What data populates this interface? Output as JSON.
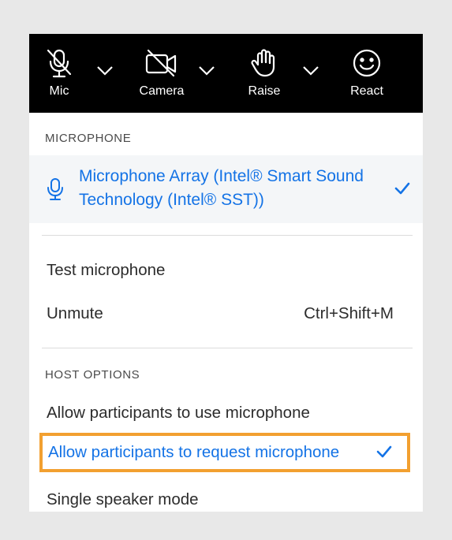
{
  "toolbar": {
    "mic": {
      "label": "Mic",
      "icon": "mic-muted-icon"
    },
    "camera": {
      "label": "Camera",
      "icon": "camera-off-icon"
    },
    "raise": {
      "label": "Raise",
      "icon": "raise-hand-icon"
    },
    "react": {
      "label": "React",
      "icon": "smiley-icon"
    }
  },
  "microphone_section": {
    "header": "MICROPHONE",
    "device_line1": "Microphone Array (Intel® Smart Sound",
    "device_line2": "Technology (Intel® SST))",
    "device_selected": true
  },
  "mic_actions": {
    "test": "Test microphone",
    "unmute": "Unmute",
    "unmute_shortcut": "Ctrl+Shift+M"
  },
  "host_options": {
    "header": "HOST OPTIONS",
    "allow_use": "Allow participants to use microphone",
    "allow_request": "Allow participants to request microphone",
    "allow_request_selected": true,
    "single_speaker": "Single speaker mode"
  },
  "colors": {
    "accent_blue": "#1473e6",
    "highlight_orange": "#f2a030",
    "toolbar_bg": "#000000"
  }
}
